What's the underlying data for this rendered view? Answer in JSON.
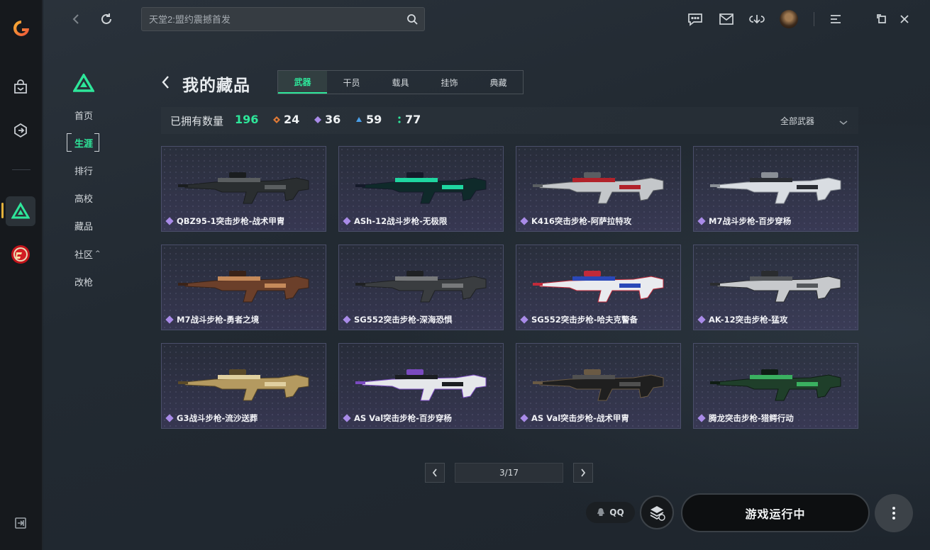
{
  "search": {
    "placeholder": "天堂2:盟约震撼首发"
  },
  "subnav": {
    "items": [
      {
        "label": "首页"
      },
      {
        "label": "生涯"
      },
      {
        "label": "排行"
      },
      {
        "label": "高校"
      },
      {
        "label": "藏品"
      },
      {
        "label": "社区"
      },
      {
        "label": "改枪"
      }
    ],
    "community_caret": "^"
  },
  "page": {
    "title": "我的藏品",
    "tabs": [
      {
        "label": "武器"
      },
      {
        "label": "干员"
      },
      {
        "label": "载具"
      },
      {
        "label": "挂饰"
      },
      {
        "label": "典藏"
      }
    ]
  },
  "stats": {
    "owned_label": "已拥有数量",
    "owned_count": "196",
    "rarities": [
      {
        "count": "24",
        "color": "#e07a36"
      },
      {
        "count": "36",
        "color": "#a98be8"
      },
      {
        "count": "59",
        "color": "#4a9fe8"
      },
      {
        "count": "77",
        "color": "#2ee69a"
      }
    ],
    "filter_label": "全部武器"
  },
  "items": [
    {
      "name": "QBZ95-1突击步枪-战术甲胄"
    },
    {
      "name": "ASh-12战斗步枪-无极限"
    },
    {
      "name": "K416突击步枪-阿萨拉特攻"
    },
    {
      "name": "M7战斗步枪-百步穿杨"
    },
    {
      "name": "M7战斗步枪-勇者之境"
    },
    {
      "name": "SG552突击步枪-深海恐惧"
    },
    {
      "name": "SG552突击步枪-哈夫克警备"
    },
    {
      "name": "AK-12突击步枪-猛攻"
    },
    {
      "name": "G3战斗步枪-流沙送葬"
    },
    {
      "name": "AS Val突击步枪-百步穿杨"
    },
    {
      "name": "AS Val突击步枪-战术甲胄"
    },
    {
      "name": "腾龙突击步枪-猎鳄行动"
    }
  ],
  "pager": {
    "label": "3/17"
  },
  "actions": {
    "qq_label": "QQ",
    "play_label": "游戏运行中"
  },
  "colors": {
    "accent": "#2ee69a",
    "card_border": "#4b4f6a",
    "rarity_purple": "#a98be8"
  }
}
